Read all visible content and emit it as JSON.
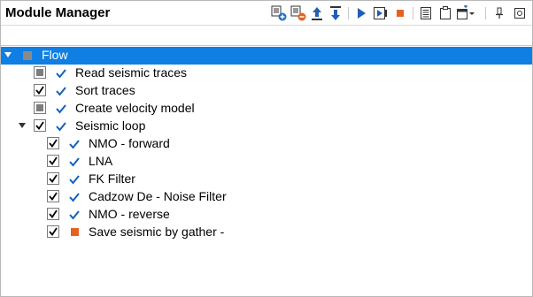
{
  "panel": {
    "title": "Module Manager"
  },
  "toolbar": {
    "buttons": [
      {
        "icon": "add-module-icon"
      },
      {
        "icon": "remove-module-icon"
      },
      {
        "icon": "move-up-icon"
      },
      {
        "icon": "move-down-icon"
      },
      {
        "icon": "run-icon"
      },
      {
        "icon": "run-step-icon"
      },
      {
        "icon": "stop-icon"
      },
      {
        "icon": "properties-icon"
      },
      {
        "icon": "clipboard-icon"
      },
      {
        "icon": "window-options-icon"
      },
      {
        "icon": "pin-icon"
      },
      {
        "icon": "close-panel-icon"
      }
    ]
  },
  "tree": {
    "root": {
      "label": "Flow",
      "selected": true,
      "expanded": true
    },
    "items": [
      {
        "label": "Read seismic traces",
        "check": "partial",
        "status": "enabled"
      },
      {
        "label": "Sort traces",
        "check": "checked",
        "status": "enabled"
      },
      {
        "label": "Create velocity model",
        "check": "partial",
        "status": "enabled"
      },
      {
        "label": "Seismic loop",
        "check": "checked",
        "status": "enabled",
        "expanded": true,
        "children": [
          {
            "label": "NMO - forward",
            "check": "checked",
            "status": "enabled"
          },
          {
            "label": "LNA",
            "check": "checked",
            "status": "enabled"
          },
          {
            "label": "FK Filter",
            "check": "checked",
            "status": "enabled"
          },
          {
            "label": "Cadzow De - Noise Filter",
            "check": "checked",
            "status": "enabled"
          },
          {
            "label": "NMO - reverse",
            "check": "checked",
            "status": "enabled"
          },
          {
            "label": "Save seismic by gather -",
            "check": "checked",
            "status": "pending"
          }
        ]
      }
    ]
  },
  "colors": {
    "selection": "#0f7fe3",
    "check_blue": "#1060c0",
    "status_orange": "#e5631f",
    "partial_gray": "#7d7d7d"
  }
}
